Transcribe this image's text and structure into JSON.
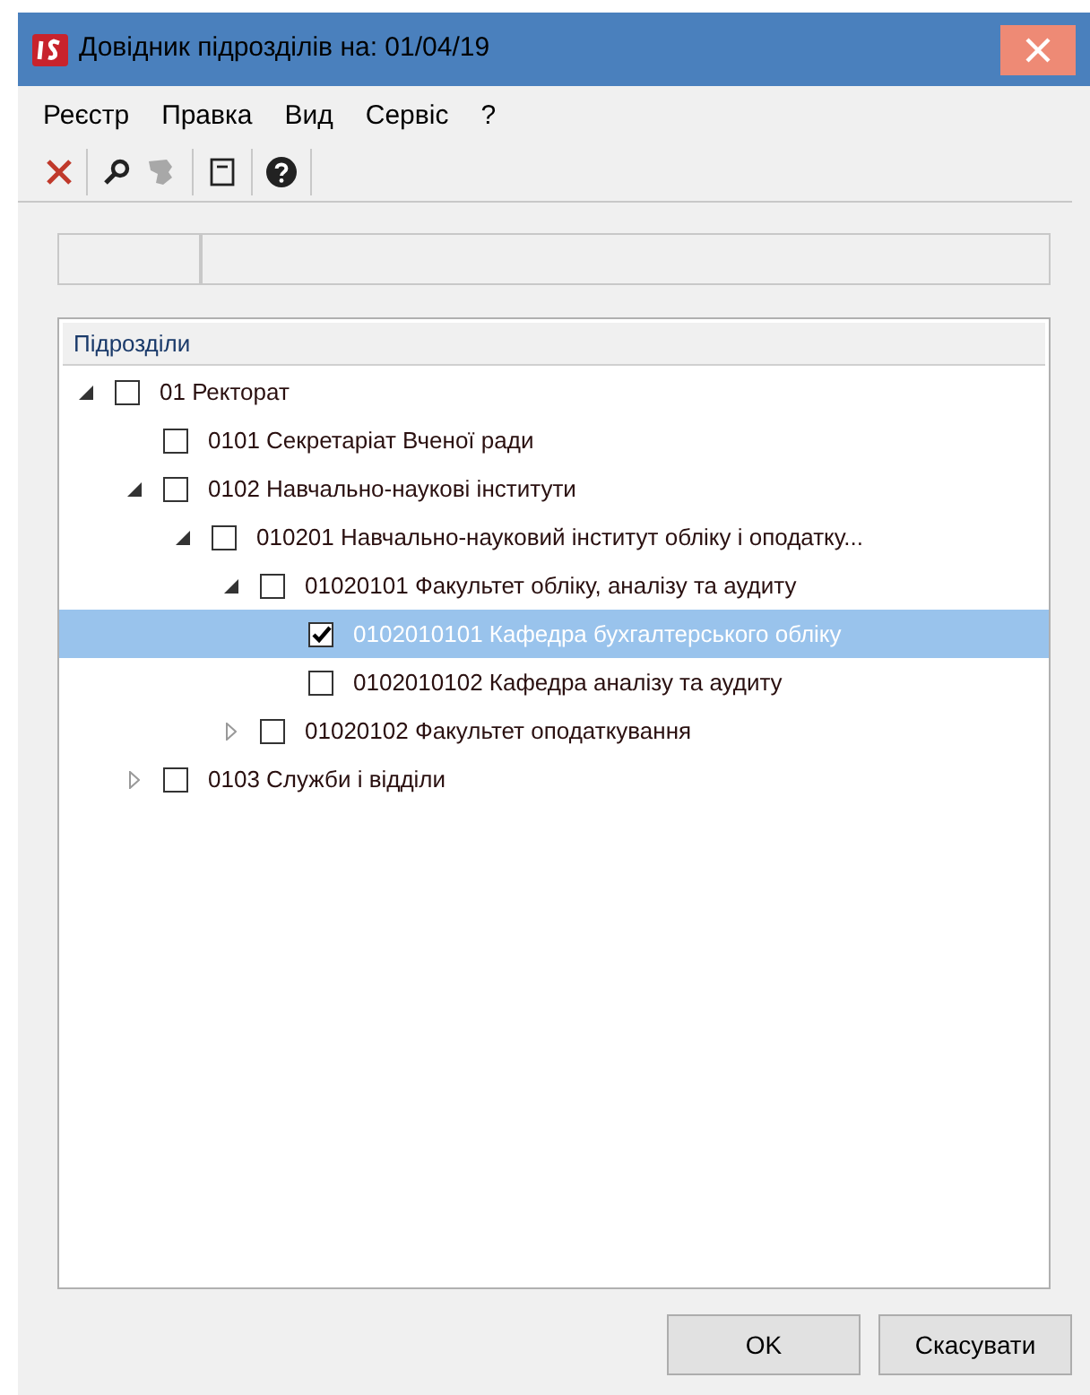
{
  "window": {
    "title": "Довідник підрозділів на: 01/04/19"
  },
  "menu": [
    "Реєстр",
    "Правка",
    "Вид",
    "Сервіс",
    "?"
  ],
  "tree": {
    "header": "Підрозділи",
    "items": [
      {
        "label": "01 Ректорат",
        "checked": false,
        "selected": false,
        "expanded": true,
        "children": [
          {
            "label": "0101 Секретаріат Вченої ради",
            "checked": false,
            "selected": false
          },
          {
            "label": "0102 Навчально-наукові інститути",
            "checked": false,
            "selected": false,
            "expanded": true,
            "children": [
              {
                "label": "010201 Навчально-науковий інститут обліку і оподатку...",
                "checked": false,
                "selected": false,
                "expanded": true,
                "children": [
                  {
                    "label": "01020101 Факультет обліку, аналізу та аудиту",
                    "checked": false,
                    "selected": false,
                    "expanded": true,
                    "children": [
                      {
                        "label": "0102010101 Кафедра бухгалтерського обліку",
                        "checked": true,
                        "selected": true
                      },
                      {
                        "label": "0102010102 Кафедра аналізу та аудиту",
                        "checked": false,
                        "selected": false
                      }
                    ]
                  },
                  {
                    "label": "01020102 Факультет оподаткування",
                    "checked": false,
                    "selected": false,
                    "expanded": false
                  }
                ]
              }
            ]
          },
          {
            "label": "0103 Служби і відділи",
            "checked": false,
            "selected": false,
            "expanded": false
          }
        ]
      }
    ]
  },
  "buttons": [
    "OK",
    "Скасувати"
  ]
}
